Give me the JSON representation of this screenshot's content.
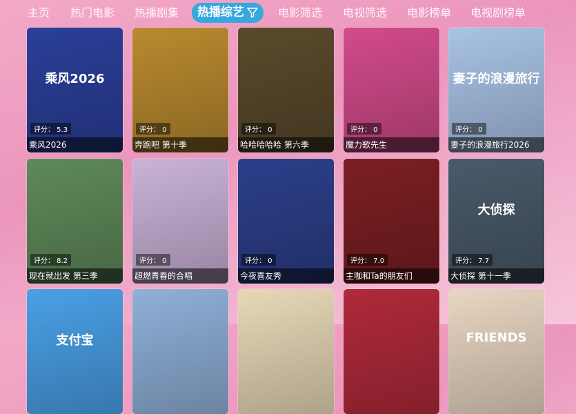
{
  "nav": {
    "tabs": [
      {
        "label": "主页"
      },
      {
        "label": "热门电影"
      },
      {
        "label": "热播剧集"
      },
      {
        "label": "热播综艺"
      },
      {
        "label": "电影筛选"
      },
      {
        "label": "电视筛选"
      },
      {
        "label": "电影榜单"
      },
      {
        "label": "电视剧榜单"
      }
    ],
    "active_index": 3,
    "active_icon": "filter-funnel-icon"
  },
  "rating_prefix": "评分：",
  "rows": [
    [
      {
        "title": "乘风2026",
        "rating": "5.3",
        "poster_text": "乘风2026",
        "bg": "#2b3f9a"
      },
      {
        "title": "奔跑吧 第十季",
        "rating": "0",
        "poster_text": "",
        "bg": "#b98a2f"
      },
      {
        "title": "哈哈哈哈哈 第六季",
        "rating": "0",
        "poster_text": "",
        "bg": "#5a4a2c"
      },
      {
        "title": "魔力歌先生",
        "rating": "0",
        "poster_text": "",
        "bg": "#d24b8a"
      },
      {
        "title": "妻子的浪漫旅行2026",
        "rating": "0",
        "poster_text": "妻子的浪漫旅行",
        "bg": "#a9c3e6"
      }
    ],
    [
      {
        "title": "现在就出发 第三季",
        "rating": "8.2",
        "poster_text": "",
        "bg": "#5f8a5a"
      },
      {
        "title": "超燃青春的合唱",
        "rating": "0",
        "poster_text": "",
        "bg": "#c9b3d8"
      },
      {
        "title": "今夜喜友秀",
        "rating": "0",
        "poster_text": "",
        "bg": "#2c3f8a"
      },
      {
        "title": "主咖和Ta的朋友们",
        "rating": "7.0",
        "poster_text": "",
        "bg": "#7b1f22"
      },
      {
        "title": "大侦探 第十一季",
        "rating": "7.7",
        "poster_text": "大侦探",
        "bg": "#4a5a6a"
      }
    ],
    [
      {
        "title": "",
        "rating": "",
        "poster_text": "支付宝",
        "bg": "#4aa0e6"
      },
      {
        "title": "",
        "rating": "",
        "poster_text": "",
        "bg": "#8fb0d8"
      },
      {
        "title": "",
        "rating": "",
        "poster_text": "",
        "bg": "#e8d8b8"
      },
      {
        "title": "",
        "rating": "",
        "poster_text": "",
        "bg": "#b02a3a"
      },
      {
        "title": "",
        "rating": "",
        "poster_text": "FRIENDS",
        "bg": "#e9d6c2"
      }
    ]
  ]
}
